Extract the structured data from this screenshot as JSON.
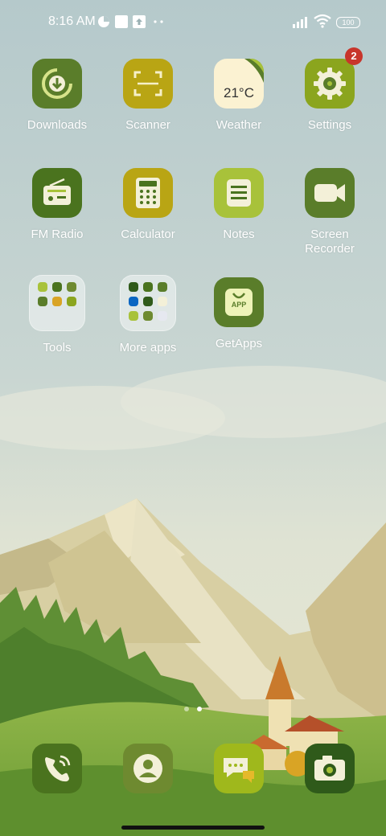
{
  "status_bar": {
    "time": "8:16 AM",
    "battery": "100",
    "icons": [
      "data-saver-icon",
      "stop-icon",
      "upload-notification-icon",
      "more-notifications-icon",
      "signal-icon",
      "wifi-icon",
      "battery-icon"
    ]
  },
  "apps": [
    {
      "label": "Downloads",
      "icon": "download-icon",
      "color": "#5a7d2a"
    },
    {
      "label": "Scanner",
      "icon": "scan-icon",
      "color": "#b9a514"
    },
    {
      "label": "Weather",
      "icon": "weather-icon",
      "temp": "21°C",
      "color": "#fbf2d2"
    },
    {
      "label": "Settings",
      "icon": "gear-icon",
      "color": "#8ba51e",
      "badge": "2"
    },
    {
      "label": "FM Radio",
      "icon": "radio-icon",
      "color": "#4a731e"
    },
    {
      "label": "Calculator",
      "icon": "calculator-icon",
      "color": "#b9a514"
    },
    {
      "label": "Notes",
      "icon": "notes-icon",
      "color": "#a8c23a"
    },
    {
      "label": "Screen\nRecorder",
      "icon": "video-camera-icon",
      "color": "#5a7d2a"
    },
    {
      "label": "Tools",
      "icon": "folder-icon"
    },
    {
      "label": "More apps",
      "icon": "folder-icon"
    },
    {
      "label": "GetApps",
      "icon": "shopping-bag-icon",
      "text": "APP",
      "color": "#5a7d2a"
    }
  ],
  "dock": [
    {
      "name": "phone",
      "icon": "phone-icon",
      "color": "#4a731e"
    },
    {
      "name": "contacts",
      "icon": "contact-icon",
      "color": "#6e8a30"
    },
    {
      "name": "messaging",
      "icon": "chat-icon",
      "color": "#9fb81c"
    },
    {
      "name": "camera",
      "icon": "camera-icon",
      "color": "#2f5a1a"
    }
  ],
  "pager": {
    "pages": 2,
    "current": 2
  }
}
